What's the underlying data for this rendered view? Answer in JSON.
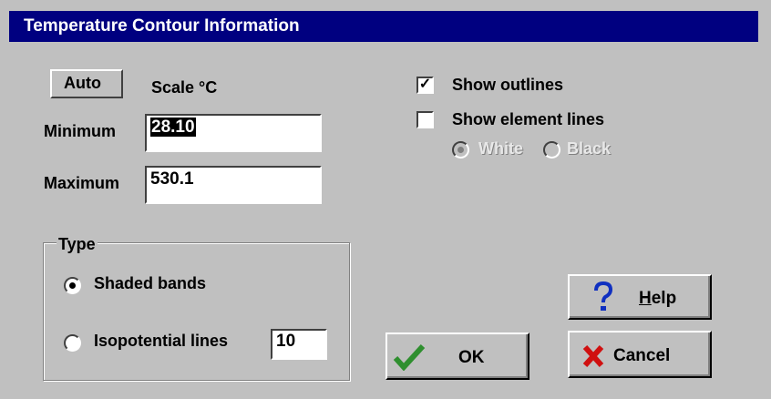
{
  "window": {
    "title": "Temperature Contour Information"
  },
  "scale": {
    "auto_label": "Auto",
    "scale_label": "Scale °C",
    "minimum_label": "Minimum",
    "minimum_value": "28.10",
    "maximum_label": "Maximum",
    "maximum_value": "530.1"
  },
  "options": {
    "show_outlines_label": "Show outlines",
    "show_outlines_checked": true,
    "show_element_lines_label": "Show element lines",
    "show_element_lines_checked": false,
    "line_color_white_label": "White",
    "line_color_black_label": "Black",
    "line_color_selected": "White",
    "checkmark": "✓"
  },
  "type_group": {
    "legend": "Type",
    "shaded_bands_label": "Shaded bands",
    "isopotential_lines_label": "Isopotential lines",
    "isopotential_count": "10",
    "selected": "Shaded bands"
  },
  "buttons": {
    "ok_label": "OK",
    "help_label_first": "H",
    "help_label_rest": "elp",
    "cancel_label": "Cancel"
  },
  "colors": {
    "title_bar": "#000080",
    "dialog_bg": "#c0c0c0",
    "ok_check": "#2f8f2f",
    "cancel_x": "#d01010",
    "help_question": "#1030c0"
  }
}
